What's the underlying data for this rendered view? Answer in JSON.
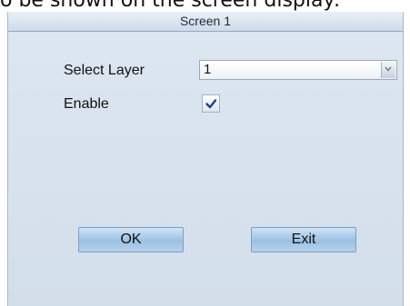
{
  "caption": "o be shown on the screen display:",
  "dialog": {
    "title": "Screen 1",
    "select_layer_label": "Select  Layer",
    "select_layer_value": "1",
    "enable_label": "Enable",
    "enable_checked": true,
    "ok_label": "OK",
    "exit_label": "Exit"
  },
  "icons": {
    "dropdown": "chevron-down-icon",
    "checkmark": "checkmark-icon"
  },
  "colors": {
    "dialog_bg": "#d8e2ee",
    "button_blue": "#9cc0e2",
    "check_blue": "#1f3f8a"
  }
}
